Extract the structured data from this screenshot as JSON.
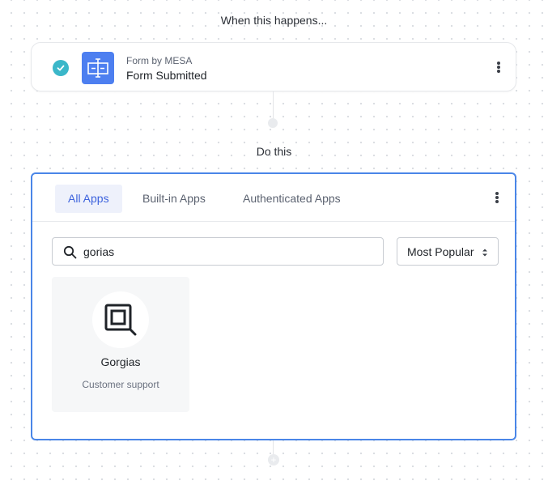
{
  "flow": {
    "trigger_heading": "When this happens...",
    "action_heading": "Do this"
  },
  "trigger": {
    "app_name": "Form by MESA",
    "event_name": "Form Submitted",
    "status": "complete",
    "icon": "form-icon",
    "icon_color": "#4d7ff0",
    "check_color": "#3bb7c9"
  },
  "action_picker": {
    "tabs": [
      {
        "label": "All Apps",
        "active": true
      },
      {
        "label": "Built-in Apps",
        "active": false
      },
      {
        "label": "Authenticated Apps",
        "active": false
      }
    ],
    "search": {
      "value": "gorias",
      "placeholder": ""
    },
    "sort": {
      "selected": "Most Popular"
    },
    "results": [
      {
        "name": "Gorgias",
        "category": "Customer support",
        "icon": "gorgias-logo-icon"
      }
    ],
    "accent_color": "#4a86e8"
  }
}
